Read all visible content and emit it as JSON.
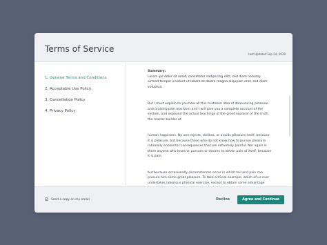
{
  "header": {
    "title": "Terms of Service",
    "last_updated": "Last Updated Sep 24, 2020"
  },
  "sidebar": {
    "items": [
      {
        "label": "1. General Terms and Conditions",
        "active": true
      },
      {
        "label": "2. Acceptable Use Policy",
        "active": false
      },
      {
        "label": "3. Cancellation Policy",
        "active": false
      },
      {
        "label": "4. Privacy Policy",
        "active": false
      }
    ]
  },
  "content": {
    "summary_label": "Summary:",
    "summary_text": "Lorem ips dolor sit amet, consetetur sadipscing elitr, sed diam nonumy eirmod tempor invidunt ut labore et dolore magna aliquyam erat, sed diam voluptua.",
    "paragraphs": [
      "But I must explain to you how all this mistaken idea of denouncing pleasure and praising pain was born and I will give you a complete account of the system, and expound the actual teachings of the great explorer of the truth, the master-builder of.",
      "human happiness. No one rejects, dislikes, or avoids pleasure itself, because it is pleasure, but because those who do not know how to pursue pleasure rationally encounter consequences that are extremely painful. Nor again is there anyone who loves or pursues or desires to obtain pain of itself, because it is pain,",
      "but because occasionally circumstances occur in which toil and pain can procure him some great pleasure. To take a trivial example, which of us ever undertakes laborious physical exercise, except to obtain some advantage from it? But who has any right to find fault with a man who chooses"
    ]
  },
  "footer": {
    "send_copy_label": "Send a copy on my email",
    "decline_label": "Decline",
    "agree_label": "Agree and Continue"
  },
  "colors": {
    "accent": "#1f857a",
    "background": "#596176",
    "panel": "#eef0f4"
  }
}
